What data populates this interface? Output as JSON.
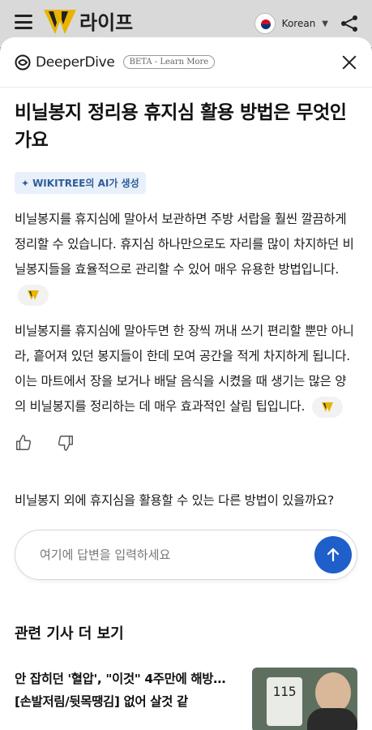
{
  "appbar": {
    "app_name": "라이프",
    "language": "Korean"
  },
  "sheet": {
    "brand": "DeeperDive",
    "beta_label": "BETA - Learn More"
  },
  "question": "비닐봉지 정리용 휴지심 활용 방법은 무엇인가요",
  "ai_badge": "WIKITREE의 AI가 생성",
  "answer": {
    "paragraph1": "비닐봉지를 휴지심에 말아서 보관하면 주방 서랍을 훨씬 깔끔하게 정리할 수 있습니다. 휴지심 하나만으로도 자리를 많이 차지하던 비닐봉지들을 효율적으로 관리할 수 있어 매우 유용한 방법입니다.",
    "paragraph2": "비닐봉지를 휴지심에 말아두면 한 장씩 꺼내 쓰기 편리할 뿐만 아니라, 흩어져 있던 봉지들이 한데 모여 공간을 적게 차지하게 됩니다. 이는 마트에서 장을 보거나 배달 음식을 시켰을 때 생기는 많은 양의 비닐봉지를 정리하는 데 매우 효과적인 살림 팁입니다."
  },
  "followup_question": "비닐봉지 외에 휴지심을 활용할 수 있는 다른 방법이 있을까요?",
  "input": {
    "placeholder": "여기에 답변을 입력하세요"
  },
  "related": {
    "title": "관련 기사 더 보기",
    "articles": [
      {
        "title": "안 잡히던 '혈압', \"이것\" 4주만에 해방… [손발저림/뒷목땡김] 없어 살것 같",
        "thumb_reading": "115"
      }
    ]
  },
  "colors": {
    "accent": "#1f5fc9",
    "badge_bg": "#e8f0fa",
    "badge_text": "#2f5d98",
    "logo_yellow": "#e9b400"
  }
}
